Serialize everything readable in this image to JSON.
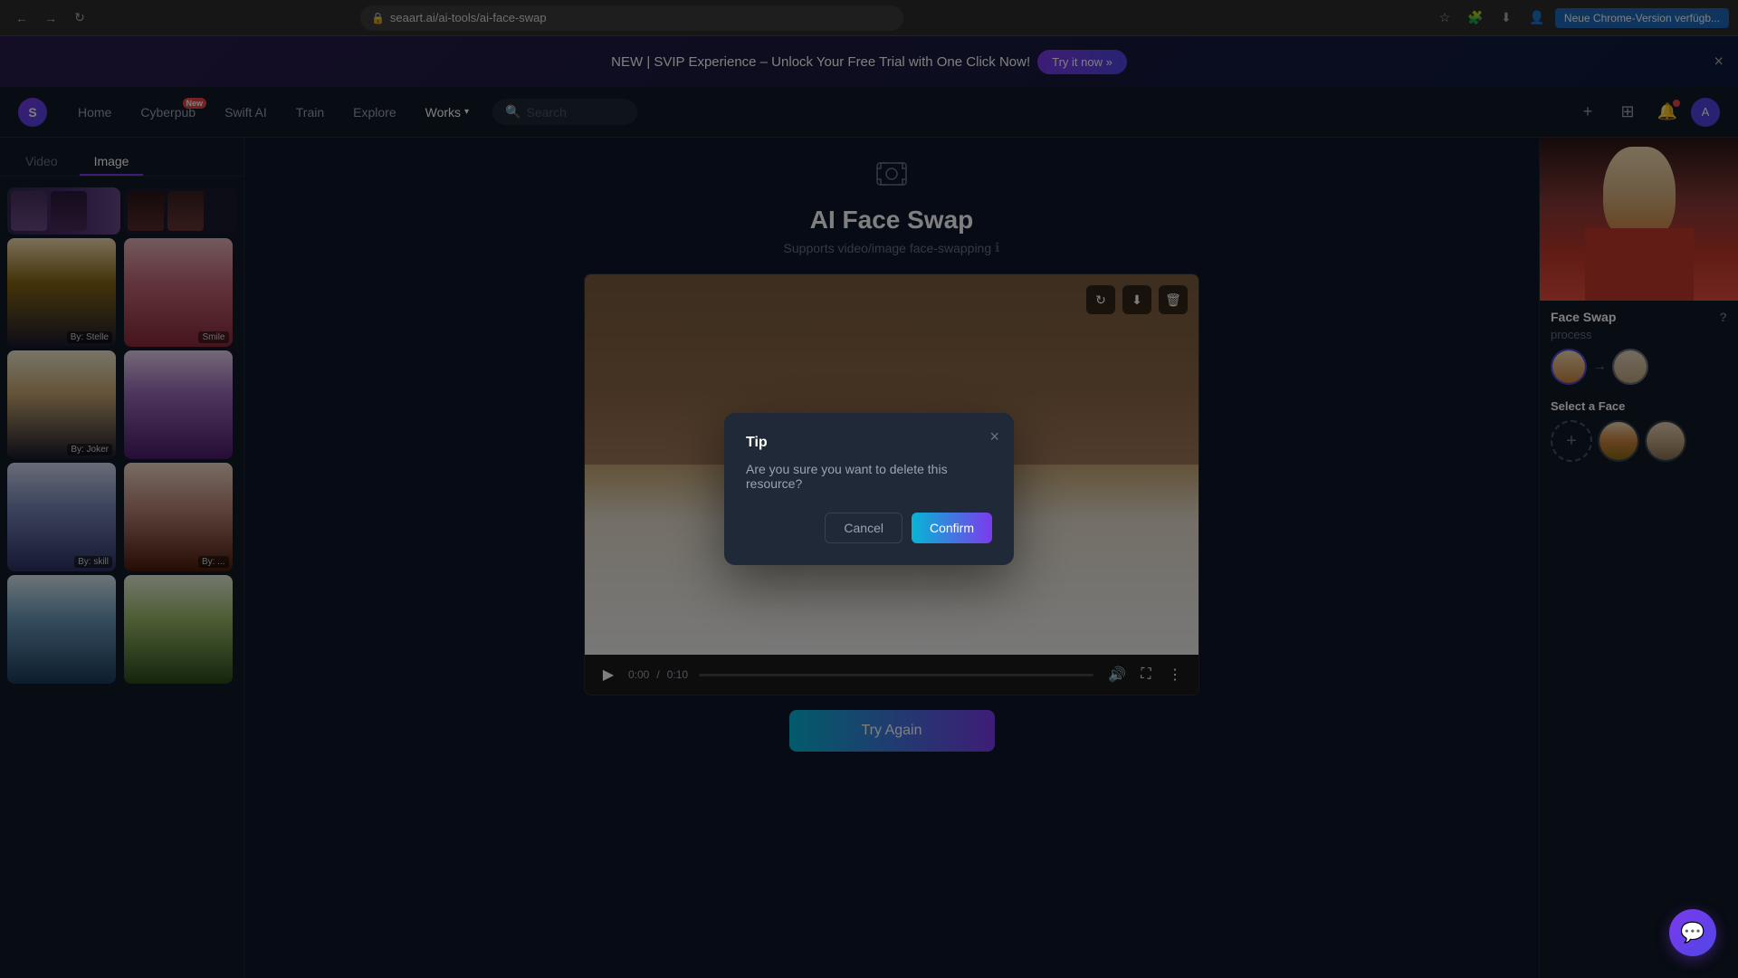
{
  "browser": {
    "url": "seaart.ai/ai-tools/ai-face-swap",
    "back_btn": "←",
    "forward_btn": "→",
    "refresh_btn": "↻",
    "update_label": "Neue Chrome-Version verfügb..."
  },
  "banner": {
    "text": "NEW | SVIP Experience – Unlock Your Free Trial with One Click Now!",
    "cta": "Try it now »",
    "close": "×"
  },
  "nav": {
    "logo": "S",
    "items": [
      {
        "label": "Home",
        "active": false
      },
      {
        "label": "Cyberpub",
        "active": false,
        "badge": "New"
      },
      {
        "label": "Swift AI",
        "active": false
      },
      {
        "label": "Train",
        "active": false
      },
      {
        "label": "Explore",
        "active": false
      },
      {
        "label": "Works",
        "active": true
      }
    ],
    "search_placeholder": "Search",
    "plus_icon": "+",
    "grid_icon": "⊞"
  },
  "page": {
    "title": "AI Face Swap",
    "subtitle": "Supports video/image face-swapping",
    "icon": "face-scan"
  },
  "sidebar_tabs": [
    {
      "label": "Video",
      "active": false
    },
    {
      "label": "Image",
      "active": true
    }
  ],
  "sidebar_images": [
    {
      "label": "By: Stelle",
      "color_class": "img-block-3"
    },
    {
      "label": "Smile",
      "color_class": "img-block-4"
    },
    {
      "label": "By: Joker",
      "color_class": "img-block-1"
    },
    {
      "label": "",
      "color_class": "img-block-5"
    },
    {
      "label": "By: skill",
      "color_class": "img-block-6"
    },
    {
      "label": "By: ...",
      "color_class": "img-block-7"
    },
    {
      "label": "",
      "color_class": "img-block-2"
    },
    {
      "label": "",
      "color_class": "img-block-8"
    }
  ],
  "video": {
    "time_current": "0:00",
    "time_total": "0:10",
    "progress": 0
  },
  "right_panel": {
    "face_swap_title": "Face Swap",
    "process_label": "process",
    "select_face_title": "Select a Face"
  },
  "modal": {
    "title": "Tip",
    "body": "Are you sure you want to delete this resource?",
    "cancel_label": "Cancel",
    "confirm_label": "Confirm",
    "close": "×"
  },
  "try_again_label": "Try Again"
}
